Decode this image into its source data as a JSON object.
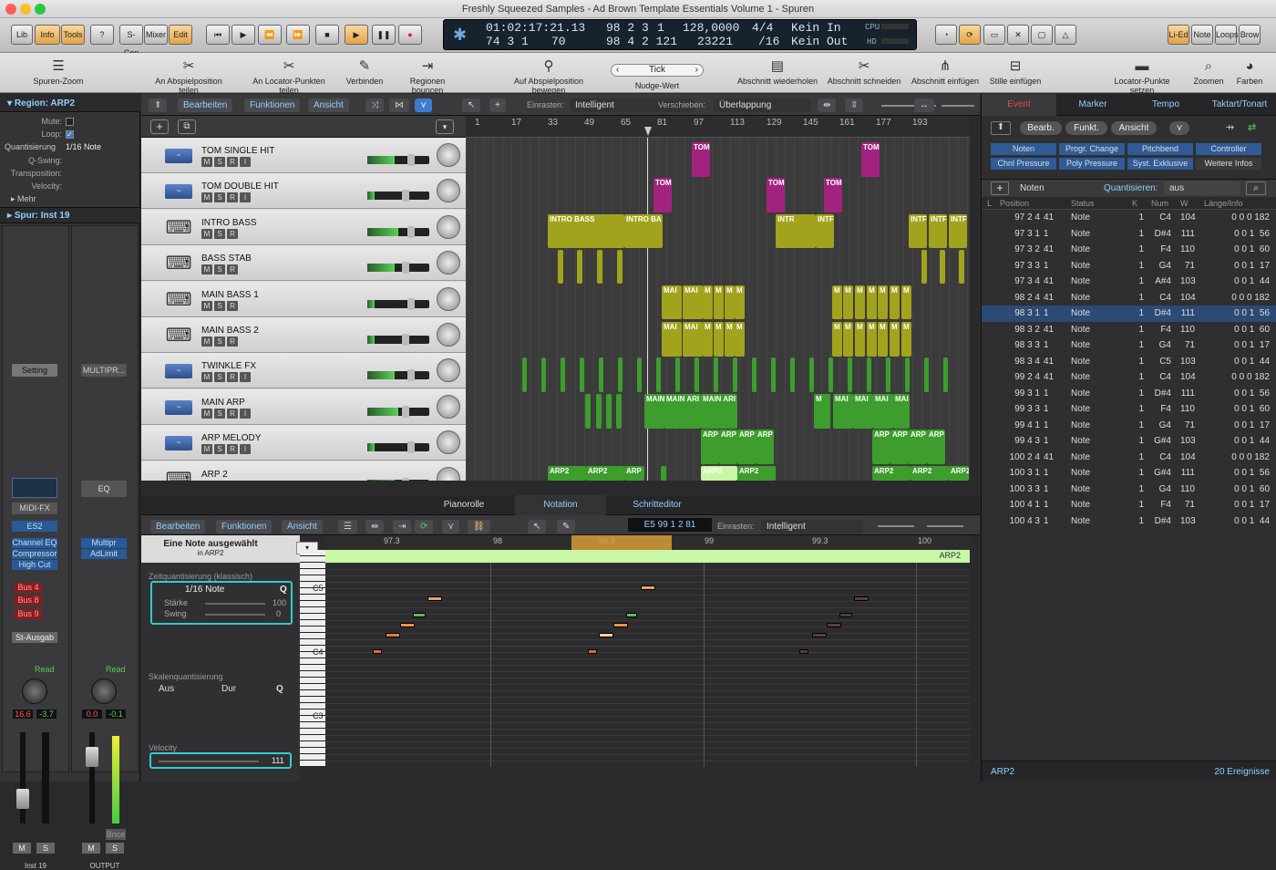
{
  "window": {
    "title": "Freshly Squeezed Samples - Ad Brown Template Essentials Volume 1 - Spuren"
  },
  "toolbar": {
    "lib": "Lib",
    "info": "Info",
    "tools": "Tools",
    "help": "?",
    "scon": "S-Con",
    "mixer": "Mixer",
    "edit": "Edit",
    "lied": "Li-Ed",
    "note": "Note",
    "loops": "Loops",
    "brow": "Brow"
  },
  "lcd": {
    "time": "01:02:17:21.13",
    "pos1": "98 2 3",
    "pos1b": "1",
    "tempo": "128,0000",
    "sig": "4/4",
    "in": "Kein In",
    "bars": "74 3 1",
    "bars_b": "70",
    "pos2": "98 4 2 121",
    "samp": "23221",
    "div": "/16",
    "out": "Kein Out",
    "cpu": "CPU",
    "hd": "HD"
  },
  "controlbar": {
    "items": [
      "Spuren-Zoom",
      "An Abspielposition teilen",
      "An Locator-Punkten teilen",
      "Verbinden",
      "Regionen bouncen",
      "Auf Abspielposition bewegen",
      "Nudge-Wert",
      "Abschnitt wiederholen",
      "Abschnitt schneiden",
      "Abschnitt einfügen",
      "Stille einfügen",
      "Locator-Punkte setzen",
      "Zoomen",
      "Farben"
    ],
    "nudge": "Tick"
  },
  "inspector": {
    "region": "Region: ARP2",
    "mute": "Mute:",
    "loop": "Loop:",
    "quant": "Quantisierung",
    "quant_val": "1/16 Note",
    "qswing": "Q-Swing:",
    "transp": "Transposition:",
    "velocity": "Velocity:",
    "mehr": "Mehr",
    "spur": "Spur: Inst 19",
    "setting": "Setting",
    "multipr": "MULTIPR...",
    "eq": "EQ",
    "midifx": "MIDI-FX",
    "es2": "ES2",
    "chan_eq": "Channel EQ",
    "compressor": "Compressor",
    "highcut": "High Cut",
    "multipr2": "Multipr",
    "adlimit": "AdLimit",
    "bus4": "Bus 4",
    "bus8": "Bus 8",
    "bus9": "Bus 9",
    "stausgab": "St-Ausgab",
    "read1": "Read",
    "read2": "Read",
    "val1": "16.6",
    "val2": "-3.7",
    "val3": "0.0",
    "val4": "-0.1",
    "bnce": "Bnce",
    "m": "M",
    "s": "S",
    "inst": "Inst 19",
    "output": "OUTPUT"
  },
  "tracksheader": {
    "bearbeiten": "Bearbeiten",
    "funktionen": "Funktionen",
    "ansicht": "Ansicht",
    "einrasten": "Einrasten:",
    "einrasten_val": "Intelligent",
    "verschieben": "Verschieben:",
    "verschieben_val": "Überlappung"
  },
  "tracks": [
    {
      "name": "TOM SINGLE HIT",
      "type": "audio"
    },
    {
      "name": "TOM DOUBLE HIT",
      "type": "audio"
    },
    {
      "name": "INTRO BASS",
      "type": "keys"
    },
    {
      "name": "BASS STAB",
      "type": "keys"
    },
    {
      "name": "MAIN BASS 1",
      "type": "keys"
    },
    {
      "name": "MAIN BASS 2",
      "type": "keys"
    },
    {
      "name": "TWINKLE FX",
      "type": "audio"
    },
    {
      "name": "MAIN ARP",
      "type": "audio"
    },
    {
      "name": "ARP MELODY",
      "type": "audio"
    },
    {
      "name": "ARP 2",
      "type": "keys"
    }
  ],
  "ruler": {
    "marks": [
      "1",
      "17",
      "33",
      "49",
      "65",
      "81",
      "97",
      "113",
      "129",
      "145",
      "161",
      "177",
      "193"
    ]
  },
  "regions": {
    "tom": "TOM",
    "intro": "INTRO BASS",
    "intro2": "INTRO BA",
    "intro3": "INTR",
    "intro4": "INTF",
    "main": "MAI",
    "m": "M",
    "main_arp": "MAIN ARI",
    "arp": "ARP",
    "arp2": "ARP2"
  },
  "lower": {
    "tabs": [
      "Pianorolle",
      "Notation",
      "Schritteditor"
    ],
    "bearbeiten": "Bearbeiten",
    "funktionen": "Funktionen",
    "ansicht": "Ansicht",
    "pos": "E5   99 1 2 81",
    "einrasten": "Einrasten:",
    "einrasten_val": "Intelligent",
    "selected": "Eine Note ausgewählt",
    "selected_sub": "in ARP2",
    "zeitq": "Zeitquantisierung (klassisch)",
    "zeitq_val": "1/16 Note",
    "staerke": "Stärke",
    "staerke_val": "100",
    "swing": "Swing",
    "swing_val": "0",
    "skalq": "Skalenquantisierung",
    "aus": "Aus",
    "dur": "Dur",
    "q": "Q",
    "velocity": "Velocity",
    "velocity_val": "111",
    "ruler": [
      "97.3",
      "98",
      "98.3",
      "99",
      "99.3",
      "100"
    ],
    "region": "ARP2",
    "keys": [
      "C5",
      "C4",
      "C3"
    ]
  },
  "eventlist": {
    "tabs": [
      "Event",
      "Marker",
      "Tempo",
      "Taktart/Tonart"
    ],
    "bearb": "Bearb.",
    "funkt": "Funkt.",
    "ansicht": "Ansicht",
    "filters": [
      "Noten",
      "Progr. Change",
      "Pitchbend",
      "Controller",
      "Chnl Pressure",
      "Poly Pressure",
      "Syst. Exklusive",
      "Weitere Infos"
    ],
    "noten": "Noten",
    "quant": "Quantisieren:",
    "quant_val": "aus",
    "cols": [
      "L",
      "Position",
      "Status",
      "K",
      "Num",
      "W",
      "Länge/Info"
    ],
    "rows": [
      [
        "97 2 4",
        "41",
        "Note",
        "1",
        "C4",
        "104",
        "0 0 0 182"
      ],
      [
        "97 3 1",
        "1",
        "Note",
        "1",
        "D#4",
        "111",
        "0 0 1  56"
      ],
      [
        "97 3 2",
        "41",
        "Note",
        "1",
        "F4",
        "110",
        "0 0 1  60"
      ],
      [
        "97 3 3",
        "1",
        "Note",
        "1",
        "G4",
        "71",
        "0 0 1  17"
      ],
      [
        "97 3 4",
        "41",
        "Note",
        "1",
        "A#4",
        "103",
        "0 0 1  44"
      ],
      [
        "98 2 4",
        "41",
        "Note",
        "1",
        "C4",
        "104",
        "0 0 0 182"
      ],
      [
        "98 3 1",
        "1",
        "Note",
        "1",
        "D#4",
        "111",
        "0 0 1  56"
      ],
      [
        "98 3 2",
        "41",
        "Note",
        "1",
        "F4",
        "110",
        "0 0 1  60"
      ],
      [
        "98 3 3",
        "1",
        "Note",
        "1",
        "G4",
        "71",
        "0 0 1  17"
      ],
      [
        "98 3 4",
        "41",
        "Note",
        "1",
        "C5",
        "103",
        "0 0 1  44"
      ],
      [
        "99 2 4",
        "41",
        "Note",
        "1",
        "C4",
        "104",
        "0 0 0 182"
      ],
      [
        "99 3 1",
        "1",
        "Note",
        "1",
        "D#4",
        "111",
        "0 0 1  56"
      ],
      [
        "99 3 3",
        "1",
        "Note",
        "1",
        "F4",
        "110",
        "0 0 1  60"
      ],
      [
        "99 4 1",
        "1",
        "Note",
        "1",
        "G4",
        "71",
        "0 0 1  17"
      ],
      [
        "99 4 3",
        "1",
        "Note",
        "1",
        "G#4",
        "103",
        "0 0 1  44"
      ],
      [
        "100 2 4",
        "41",
        "Note",
        "1",
        "C4",
        "104",
        "0 0 0 182"
      ],
      [
        "100 3 1",
        "1",
        "Note",
        "1",
        "G#4",
        "111",
        "0 0 1  56"
      ],
      [
        "100 3 3",
        "1",
        "Note",
        "1",
        "G4",
        "110",
        "0 0 1  60"
      ],
      [
        "100 4 1",
        "1",
        "Note",
        "1",
        "F4",
        "71",
        "0 0 1  17"
      ],
      [
        "100 4 3",
        "1",
        "Note",
        "1",
        "D#4",
        "103",
        "0 0 1  44"
      ]
    ],
    "footer_left": "ARP2",
    "footer_right": "20 Ereignisse"
  }
}
